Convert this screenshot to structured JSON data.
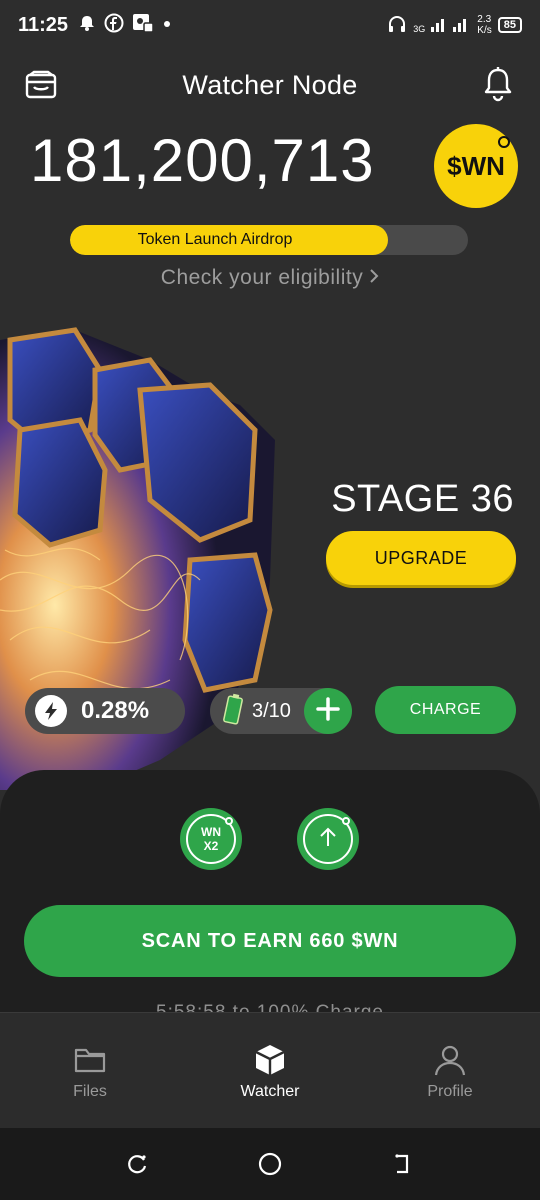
{
  "status_bar": {
    "time": "11:25",
    "network_type": "3G",
    "speed": "2.3",
    "speed_unit": "K/s",
    "battery": "85"
  },
  "header": {
    "title": "Watcher Node"
  },
  "balance": {
    "amount": "181,200,713",
    "token_symbol": "$WN"
  },
  "airdrop": {
    "label": "Token Launch Airdrop",
    "progress": 0.8,
    "eligibility_link": "Check your eligibility"
  },
  "node": {
    "stage_label": "STAGE 36",
    "upgrade_label": "UPGRADE",
    "rate": "0.28%",
    "battery_count": "3/10",
    "charge_label": "CHARGE"
  },
  "boosts": {
    "x2_line1": "WN",
    "x2_line2": "X2"
  },
  "scan": {
    "label": "SCAN TO EARN 660 $WN",
    "timer_text": "5:58:58 to 100% Charge"
  },
  "nav": {
    "items": [
      {
        "label": "Files",
        "icon": "folder-icon"
      },
      {
        "label": "Watcher",
        "icon": "cube-icon"
      },
      {
        "label": "Profile",
        "icon": "person-icon"
      }
    ],
    "active": "Watcher"
  },
  "colors": {
    "background": "#2d2d2d",
    "accent_yellow": "#f8d20a",
    "accent_green": "#2fa54a",
    "panel": "#1f1f1f"
  }
}
